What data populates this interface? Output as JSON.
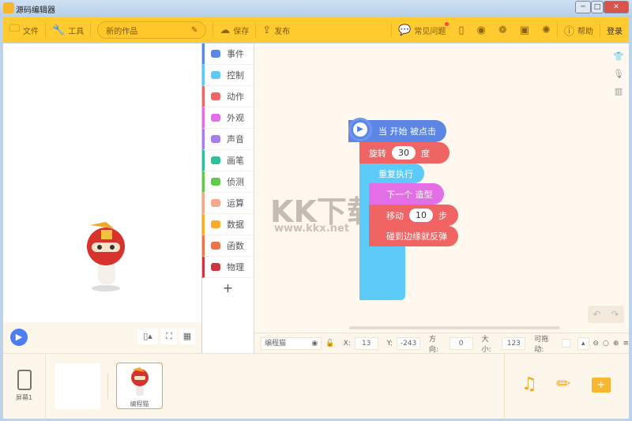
{
  "window": {
    "title": "源码编辑器",
    "minimize": "─",
    "maximize": "□",
    "close": "✕"
  },
  "toolbar": {
    "file": "文件",
    "tools": "工具",
    "project_name": "新的作品",
    "save": "保存",
    "publish": "发布",
    "faq": "常见问题",
    "help": "帮助",
    "login": "登录"
  },
  "categories": [
    {
      "label": "事件",
      "color": "#5b86e5"
    },
    {
      "label": "控制",
      "color": "#5fc8f5"
    },
    {
      "label": "动作",
      "color": "#f06666"
    },
    {
      "label": "外观",
      "color": "#e46ee6"
    },
    {
      "label": "声音",
      "color": "#a77ef0"
    },
    {
      "label": "画笔",
      "color": "#2fc09a"
    },
    {
      "label": "侦测",
      "color": "#62c94c"
    },
    {
      "label": "运算",
      "color": "#f7a98a"
    },
    {
      "label": "数据",
      "color": "#fcaa2a"
    },
    {
      "label": "函数",
      "color": "#f0744a"
    },
    {
      "label": "物理",
      "color": "#d0343f"
    }
  ],
  "add_category": "+",
  "blocks": {
    "when_start": "当 开始 被点击",
    "rotate": "旋转",
    "rotate_val": "30",
    "rotate_unit": "度",
    "repeat": "重复执行",
    "next_costume": "下一个 造型",
    "move": "移动",
    "move_val": "10",
    "move_unit": "步",
    "bounce": "碰到边缘就反弹"
  },
  "watermark": {
    "title": "KK下载",
    "url": "www.kkx.net"
  },
  "props": {
    "sprite_name": "编程猫",
    "x_label": "X:",
    "x": "13",
    "y_label": "Y:",
    "y": "-243",
    "dir_label": "方向:",
    "dir": "0",
    "size_label": "大小:",
    "size": "123",
    "drag_label": "可拖动:"
  },
  "bottom": {
    "screen": "屏幕1",
    "sprite": "编程猫"
  }
}
